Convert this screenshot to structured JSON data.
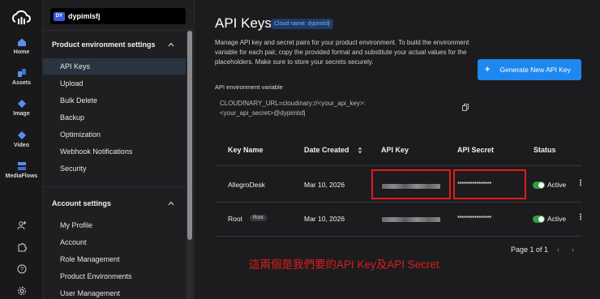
{
  "rail": {
    "items": [
      {
        "label": "Home",
        "icon": "home-icon"
      },
      {
        "label": "Assets",
        "icon": "assets-icon"
      },
      {
        "label": "Image",
        "icon": "image-icon"
      },
      {
        "label": "Video",
        "icon": "video-icon"
      },
      {
        "label": "MediaFlows",
        "icon": "mediaflows-icon"
      }
    ],
    "bottom_icons": [
      "add-user-icon",
      "puzzle-icon",
      "help-icon",
      "settings-icon"
    ]
  },
  "sidebar": {
    "env_badge": "DY",
    "env_name": "dypimlsfj",
    "product_section": "Product environment settings",
    "product_items": [
      "API Keys",
      "Upload",
      "Bulk Delete",
      "Backup",
      "Optimization",
      "Webhook Notifications",
      "Security"
    ],
    "account_section": "Account settings",
    "account_items": [
      "My Profile",
      "Account",
      "Role Management",
      "Product Environments",
      "User Management"
    ]
  },
  "main": {
    "title": "API Keys",
    "cloud_badge": "Cloud name: dypimlsfj",
    "description": "Manage API key and secret pairs for your product environment. To build the environment variable for each pair, copy the provided format and substitute your actual values for the placeholders. Make sure to store your secrets securely.",
    "generate_button": "Generate New API Key",
    "env_var_label": "API environment variable",
    "env_var_value": "CLOUDINARY_URL=cloudinary://<your_api_key>:<your_api_secret>@dypimlsfj",
    "table": {
      "headers": [
        "Key Name",
        "Date Created",
        "API Key",
        "API Secret",
        "Status"
      ],
      "rows": [
        {
          "name": "AllegroDesk",
          "tag": "",
          "date": "Mar 10, 2026",
          "secret": "****************",
          "status": "Active"
        },
        {
          "name": "Root",
          "tag": "Root",
          "date": "Mar 10, 2026",
          "secret": "****************",
          "status": "Active"
        }
      ]
    },
    "pagination": "Page 1 of 1",
    "annotation": "這兩個是我們要的API Key及API Secret"
  },
  "colors": {
    "accent": "#1e88f0",
    "active_toggle": "#2ea043",
    "annotation": "#e01b1b"
  }
}
